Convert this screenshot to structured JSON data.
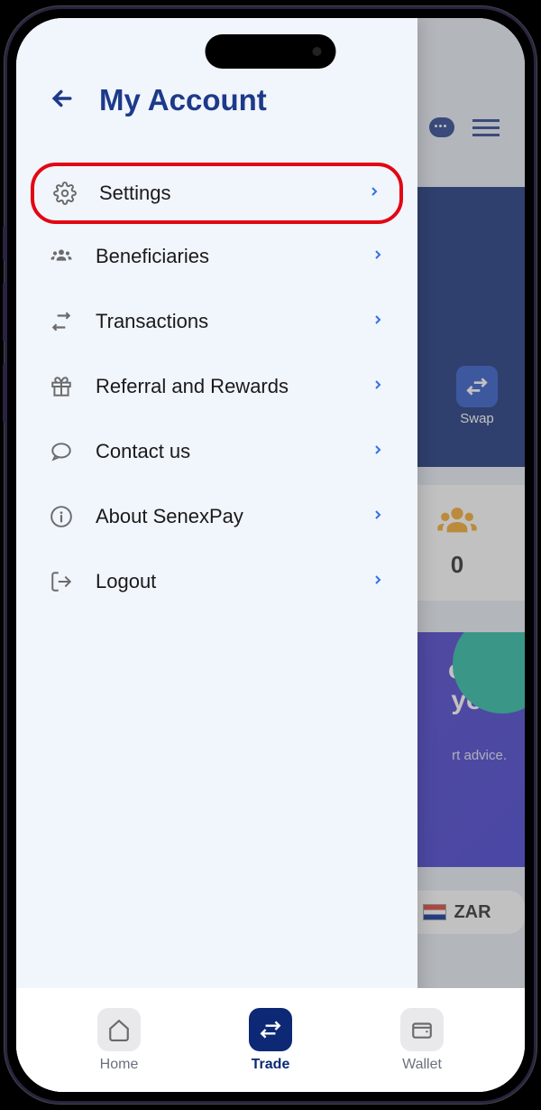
{
  "panel": {
    "title": "My Account",
    "items": [
      {
        "icon": "gear",
        "label": "Settings",
        "highlighted": true
      },
      {
        "icon": "people",
        "label": "Beneficiaries"
      },
      {
        "icon": "transfer",
        "label": "Transactions"
      },
      {
        "icon": "gift",
        "label": "Referral and Rewards"
      },
      {
        "icon": "chat",
        "label": "Contact us"
      },
      {
        "icon": "info",
        "label": "About SenexPay"
      },
      {
        "icon": "logout",
        "label": "Logout"
      }
    ]
  },
  "backdrop": {
    "swap_label": "Swap",
    "referral_count": "0",
    "promo_line1": "oto?",
    "promo_line2": "you.",
    "promo_sub": "rt advice.",
    "currency": "ZAR"
  },
  "nav": {
    "items": [
      {
        "icon": "home",
        "label": "Home",
        "active": false
      },
      {
        "icon": "trade",
        "label": "Trade",
        "active": true
      },
      {
        "icon": "wallet",
        "label": "Wallet",
        "active": false
      }
    ]
  }
}
